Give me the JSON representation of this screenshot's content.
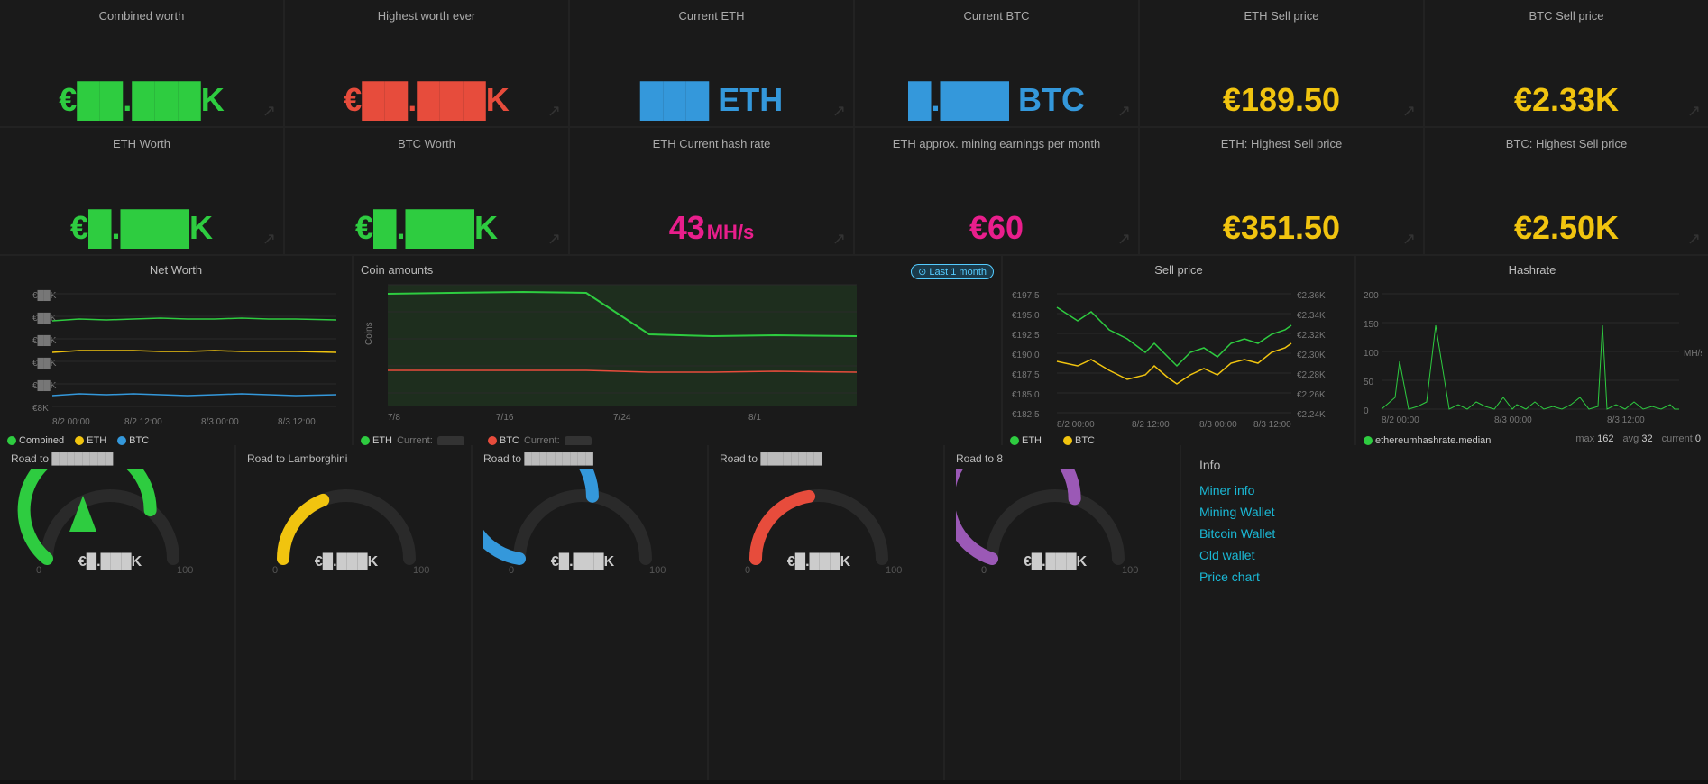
{
  "stats_row1": [
    {
      "title": "Combined worth",
      "value": "€██.███K",
      "value_display": "€██.███K",
      "color": "val-green"
    },
    {
      "title": "Highest worth ever",
      "value": "€██.███K",
      "value_display": "€██.███K",
      "color": "val-red"
    },
    {
      "title": "Current ETH",
      "value": "███ ETH",
      "color": "val-blue"
    },
    {
      "title": "Current BTC",
      "value": "█.███ BTC",
      "color": "val-blue"
    },
    {
      "title": "ETH Sell price",
      "value": "€189.50",
      "color": "val-yellow"
    },
    {
      "title": "BTC Sell price",
      "value": "€2.33K",
      "color": "val-yellow"
    }
  ],
  "stats_row2": [
    {
      "title": "ETH Worth",
      "value": "€█.███K",
      "color": "val-green"
    },
    {
      "title": "BTC Worth",
      "value": "€█.███K",
      "color": "val-green"
    },
    {
      "title": "ETH Current hash rate",
      "value": "43",
      "unit": "MH/s",
      "color": "val-pink"
    },
    {
      "title": "ETH approx. mining earnings per month",
      "value": "€60",
      "color": "val-pink"
    },
    {
      "title": "ETH: Highest Sell price",
      "value": "€351.50",
      "color": "val-yellow"
    },
    {
      "title": "BTC: Highest Sell price",
      "value": "€2.50K",
      "color": "val-yellow"
    }
  ],
  "charts": {
    "net_worth": {
      "title": "Net Worth",
      "y_labels": [
        "€██K",
        "€██K",
        "€██K",
        "€██K",
        "€██K",
        "€8K"
      ],
      "x_labels": [
        "8/2 00:00",
        "8/2 12:00",
        "8/3 00:00",
        "8/3 12:00"
      ],
      "legend": [
        {
          "label": "Combined",
          "color": "#2ecc40"
        },
        {
          "label": "ETH",
          "color": "#f1c40f"
        },
        {
          "label": "BTC",
          "color": "#3498db"
        }
      ]
    },
    "coin_amounts": {
      "title": "Coin amounts",
      "badge": "Last 1 month",
      "x_labels": [
        "7/8",
        "7/16",
        "7/24",
        "8/1"
      ],
      "legend": [
        {
          "label": "ETH",
          "color": "#2ecc40",
          "current": "███"
        },
        {
          "label": "BTC",
          "color": "#e74c3c",
          "current": "███"
        }
      ],
      "y_label": "Coins"
    },
    "sell_price": {
      "title": "Sell price",
      "y_labels_left": [
        "€197.5",
        "€195.0",
        "€192.5",
        "€190.0",
        "€187.5",
        "€185.0",
        "€182.5"
      ],
      "y_labels_right": [
        "€2.36K",
        "€2.34K",
        "€2.32K",
        "€2.30K",
        "€2.28K",
        "€2.26K",
        "€2.24K"
      ],
      "x_labels": [
        "8/2 00:00",
        "8/2 12:00",
        "8/3 00:00",
        "8/3 12:00"
      ],
      "legend": [
        {
          "label": "ETH",
          "color": "#2ecc40"
        },
        {
          "label": "BTC",
          "color": "#f1c40f"
        }
      ]
    },
    "hashrate": {
      "title": "Hashrate",
      "y_labels": [
        "200",
        "150",
        "100",
        "50",
        "0"
      ],
      "x_labels": [
        "8/2 00:00",
        "8/3 00:00",
        "8/3 12:00"
      ],
      "stats": {
        "max": "162",
        "avg": "32",
        "current": "0"
      },
      "legend": [
        {
          "label": "ethereumhashrate.median",
          "color": "#2ecc40"
        }
      ],
      "y_unit": "MH/s"
    }
  },
  "road_cards": [
    {
      "title": "Road to",
      "target": "████████",
      "value": "€█.███K",
      "progress": 0.72
    },
    {
      "title": "Road to Lamborghini",
      "target": "",
      "value": "€█.███K",
      "progress": 0.38
    },
    {
      "title": "Road to",
      "target": "█████████",
      "value": "€█.███K",
      "progress": 0.55
    },
    {
      "title": "Road to",
      "target": "████████",
      "value": "€█.███K",
      "progress": 0.45
    },
    {
      "title": "Road to 8",
      "target": "",
      "value": "€█.███K",
      "progress": 0.6
    }
  ],
  "info": {
    "title": "Info",
    "links": [
      {
        "label": "Miner info",
        "href": "#"
      },
      {
        "label": "Mining Wallet",
        "href": "#"
      },
      {
        "label": "Bitcoin Wallet",
        "href": "#"
      },
      {
        "label": "Old wallet",
        "href": "#"
      },
      {
        "label": "Price chart",
        "href": "#"
      }
    ]
  }
}
